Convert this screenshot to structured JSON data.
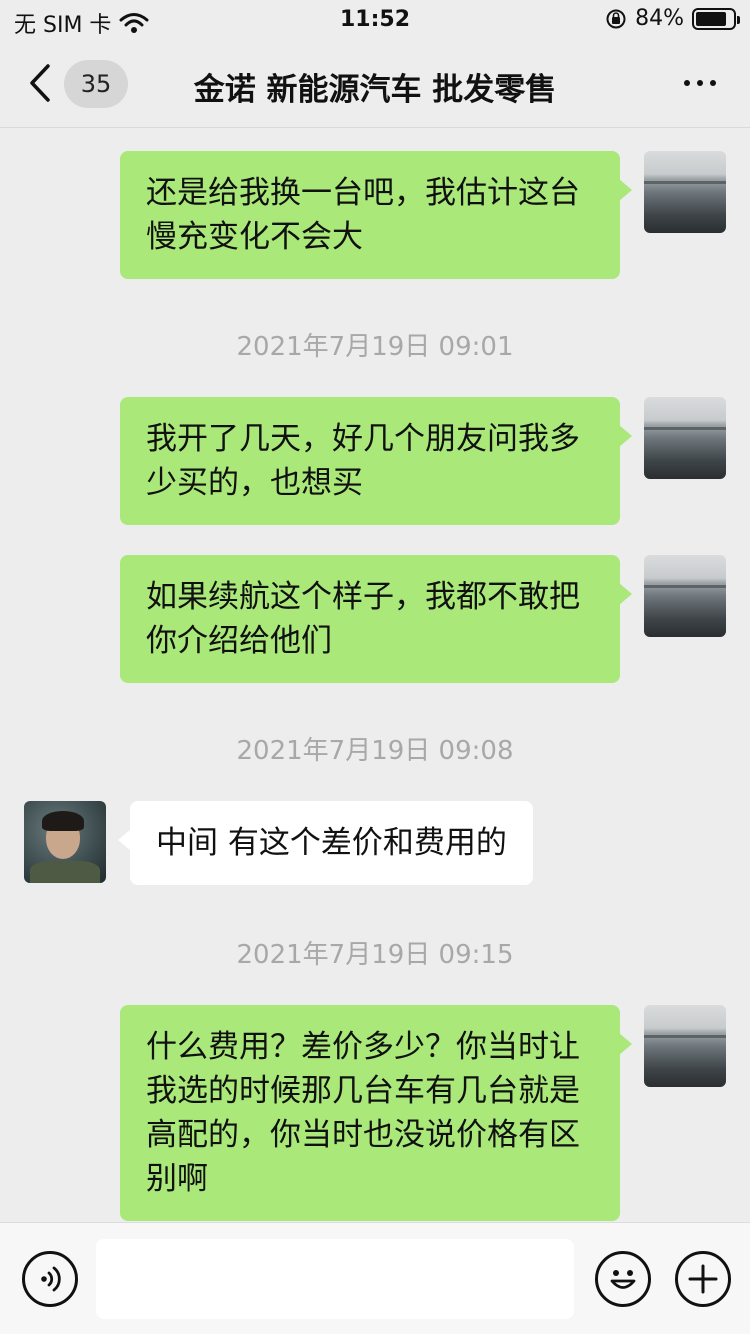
{
  "status_bar": {
    "carrier": "无 SIM 卡",
    "time": "11:52",
    "battery_percent": "84%",
    "battery_level": 0.84
  },
  "nav": {
    "unread_count": "35",
    "title": "金诺 新能源汽车 批发零售"
  },
  "messages": [
    {
      "type": "self",
      "text": "还是给我换一台吧，我估计这台慢充变化不会大"
    },
    {
      "type": "time",
      "text": "2021年7月19日 09:01"
    },
    {
      "type": "self",
      "text": "我开了几天，好几个朋友问我多少买的，也想买"
    },
    {
      "type": "self",
      "text": "如果续航这个样子，我都不敢把你介绍给他们"
    },
    {
      "type": "time",
      "text": "2021年7月19日 09:08"
    },
    {
      "type": "other",
      "text": "中间 有这个差价和费用的"
    },
    {
      "type": "time",
      "text": "2021年7月19日 09:15"
    },
    {
      "type": "self",
      "text": "什么费用？差价多少？你当时让我选的时候那几台车有几台就是高配的，你当时也没说价格有区别啊"
    }
  ],
  "input": {
    "placeholder": ""
  }
}
